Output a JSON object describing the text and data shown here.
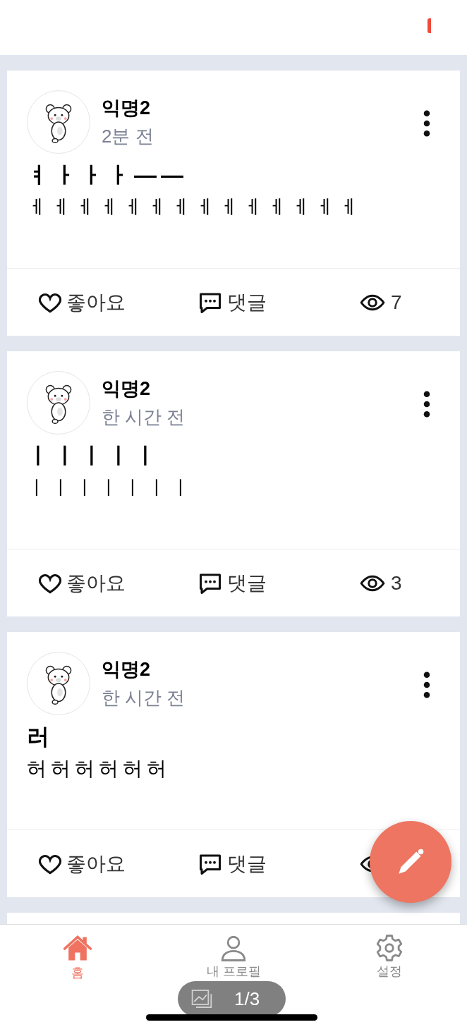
{
  "posts": [
    {
      "author": "익명2",
      "time": "2분 전",
      "title": "ㅕㅏㅏㅏ——",
      "body": "ㅔㅔㅔㅔㅔㅔㅔㅔㅔㅔㅔㅔㅔㅔ",
      "like": "좋아요",
      "comment": "댓글",
      "views": "7"
    },
    {
      "author": "익명2",
      "time": "한 시간 전",
      "title": "ㅣㅣㅣㅣㅣ",
      "body": "ㅣㅣㅣㅣㅣㅣㅣ",
      "like": "좋아요",
      "comment": "댓글",
      "views": "3"
    },
    {
      "author": "익명2",
      "time": "한 시간 전",
      "title": "러",
      "body": "허허허허허허",
      "like": "좋아요",
      "comment": "댓글"
    }
  ],
  "nav": [
    {
      "label": "홈",
      "selected": true
    },
    {
      "label": "내 프로필",
      "selected": false
    },
    {
      "label": "설정",
      "selected": false
    }
  ],
  "image_counter": "1/3"
}
